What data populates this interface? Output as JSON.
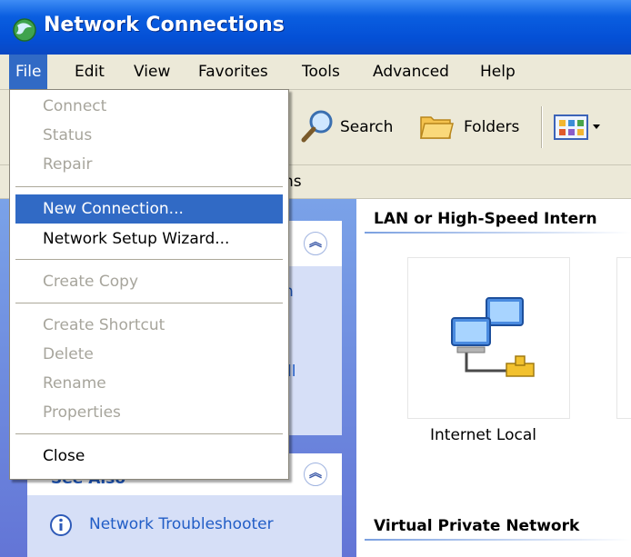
{
  "window": {
    "title": "Network Connections"
  },
  "menubar": [
    "File",
    "Edit",
    "View",
    "Favorites",
    "Tools",
    "Advanced",
    "Help"
  ],
  "toolbar": {
    "search": "Search",
    "folders": "Folders"
  },
  "address": {
    "text_partial": "ns"
  },
  "file_menu": {
    "items": [
      {
        "label": "Connect",
        "state": "disabled"
      },
      {
        "label": "Status",
        "state": "disabled"
      },
      {
        "label": "Repair",
        "state": "disabled"
      },
      {
        "label": "New Connection...",
        "state": "highlighted"
      },
      {
        "label": "Network Setup Wizard...",
        "state": "enabled"
      },
      {
        "label": "Create Copy",
        "state": "disabled"
      },
      {
        "label": "Create Shortcut",
        "state": "disabled"
      },
      {
        "label": "Delete",
        "state": "disabled"
      },
      {
        "label": "Rename",
        "state": "disabled"
      },
      {
        "label": "Properties",
        "state": "disabled"
      },
      {
        "label": "Close",
        "state": "enabled"
      }
    ]
  },
  "left_pane": {
    "partial_char_1": "n",
    "partial_char_2": "ll",
    "see_also_title": "See Also",
    "troubleshooter": "Network Troubleshooter"
  },
  "right_pane": {
    "group1": "LAN or High-Speed Intern",
    "connection_name": "Internet Local",
    "group2": "Virtual Private Network"
  },
  "colors": {
    "titlebar": "#0a5ee0",
    "menu_highlight": "#316ac5",
    "task_pane": "#6f8ee0",
    "link": "#215dc6"
  }
}
